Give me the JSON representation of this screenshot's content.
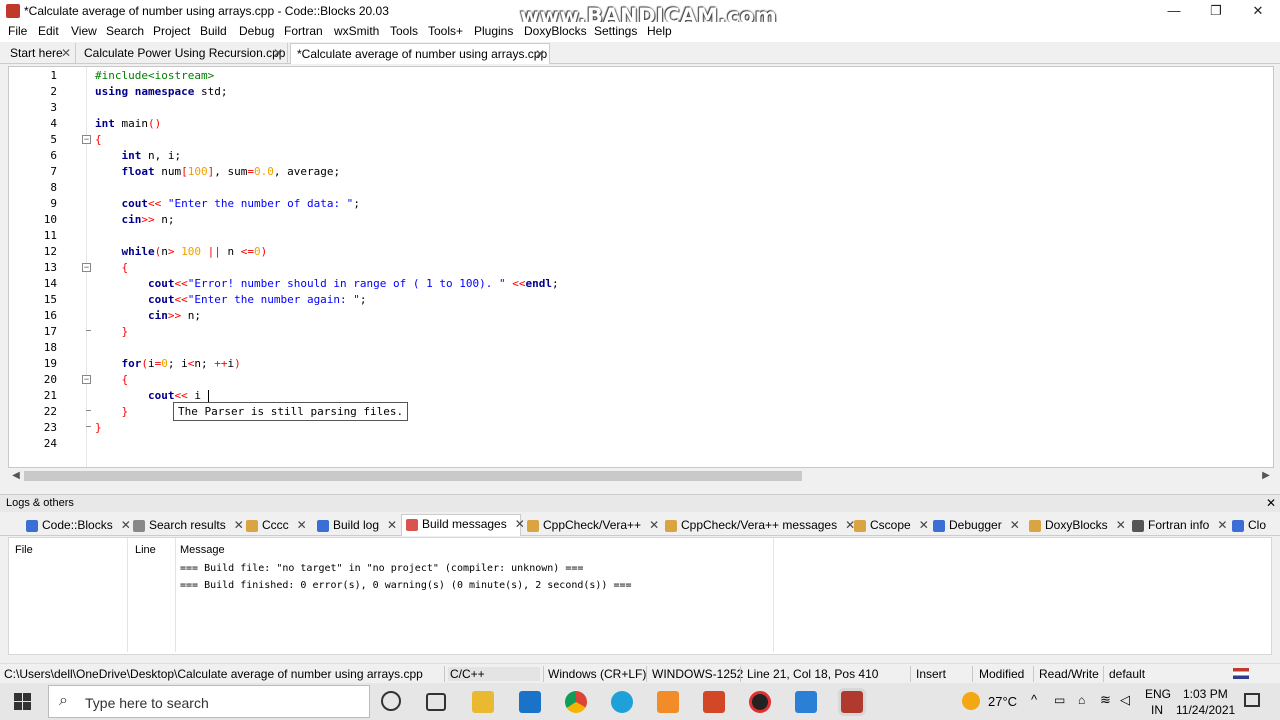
{
  "window": {
    "title": "*Calculate average of number using arrays.cpp - Code::Blocks 20.03",
    "watermark": "www.BANDICAM.com",
    "minimize": "—",
    "maximize": "❐",
    "close": "✕"
  },
  "menu": [
    "File",
    "Edit",
    "View",
    "Search",
    "Project",
    "Build",
    "Debug",
    "Fortran",
    "wxSmith",
    "Tools",
    "Tools+",
    "Plugins",
    "DoxyBlocks",
    "Settings",
    "Help"
  ],
  "tabs": [
    {
      "label": "Start here",
      "close": "✕"
    },
    {
      "label": "Calculate Power Using Recursion.cpp",
      "close": "✕"
    },
    {
      "label": "*Calculate average of number using arrays.cpp",
      "close": "✕"
    }
  ],
  "editor": {
    "line_numbers": [
      "1",
      "2",
      "3",
      "4",
      "5",
      "6",
      "7",
      "8",
      "9",
      "10",
      "11",
      "12",
      "13",
      "14",
      "15",
      "16",
      "17",
      "18",
      "19",
      "20",
      "21",
      "22",
      "23",
      "24"
    ],
    "tooltip": "The Parser is still parsing files."
  },
  "logs": {
    "title": "Logs & others",
    "close": "✕",
    "tabs": [
      {
        "label": "Code::Blocks",
        "color": "#3b6fd6"
      },
      {
        "label": "Search results",
        "color": "#888888"
      },
      {
        "label": "Cccc",
        "color": "#d9a441"
      },
      {
        "label": "Build log",
        "color": "#3b6fd6"
      },
      {
        "label": "Build messages",
        "color": "#d9534f"
      },
      {
        "label": "CppCheck/Vera++",
        "color": "#d9a441"
      },
      {
        "label": "CppCheck/Vera++ messages",
        "color": "#d9a441"
      },
      {
        "label": "Cscope",
        "color": "#d9a441"
      },
      {
        "label": "Debugger",
        "color": "#3b6fd6"
      },
      {
        "label": "DoxyBlocks",
        "color": "#d9a441"
      },
      {
        "label": "Fortran info",
        "color": "#555555"
      },
      {
        "label": "Clo",
        "color": "#3b6fd6"
      }
    ],
    "columns": {
      "file": "File",
      "line": "Line",
      "message": "Message"
    },
    "messages": [
      "=== Build file: \"no target\" in \"no project\" (compiler: unknown) ===",
      "=== Build finished: 0 error(s), 0 warning(s) (0 minute(s), 2 second(s)) ==="
    ]
  },
  "status": {
    "path": "C:\\Users\\dell\\OneDrive\\Desktop\\Calculate average of number using arrays.cpp",
    "language": "C/C++",
    "eol": "Windows (CR+LF)",
    "encoding": "WINDOWS-1252",
    "position": "Line 21, Col 18, Pos 410",
    "mode": "Insert",
    "modified": "Modified",
    "access": "Read/Write",
    "profile": "default"
  },
  "taskbar": {
    "search_placeholder": "Type here to search",
    "temperature": "27°C",
    "language": "ENG",
    "region": "IN",
    "time": "1:03 PM",
    "date": "11/24/2021"
  }
}
